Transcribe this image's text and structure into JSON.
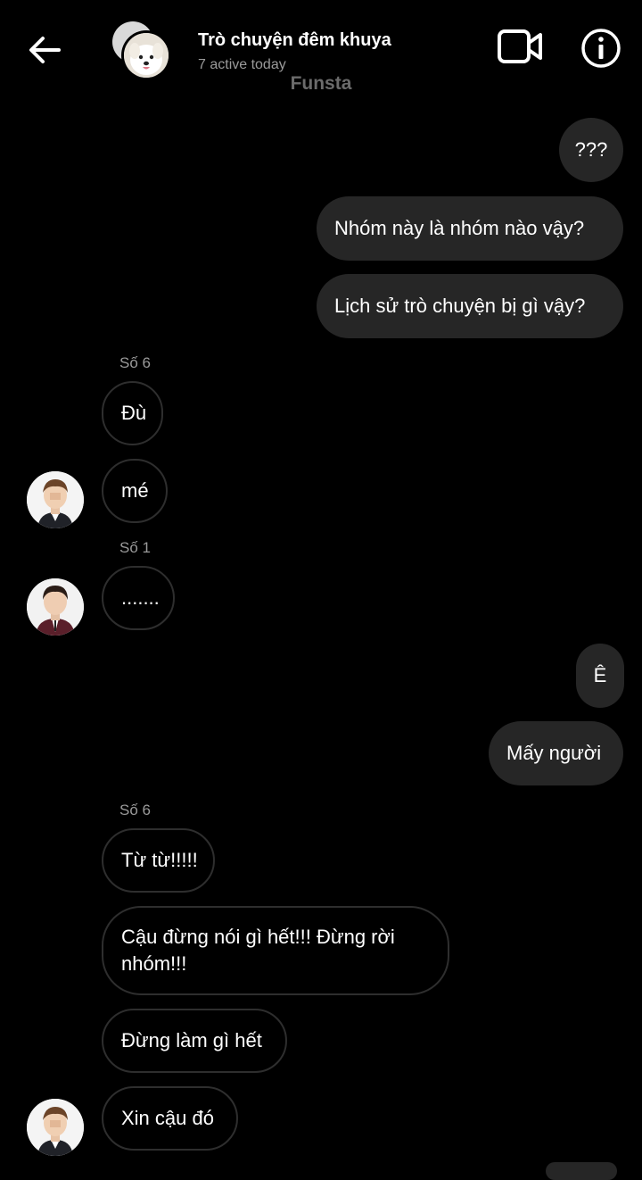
{
  "header": {
    "title": "Trò chuyện đêm khuya",
    "subtitle": "7 active today",
    "app_name": "Funsta",
    "icons": {
      "back": "arrow-left-icon",
      "video": "video-camera-icon",
      "info": "info-icon"
    }
  },
  "colors": {
    "background": "#000000",
    "outgoing_bubble": "#262626",
    "incoming_border": "#2e2e2e",
    "muted_text": "#9a9a9a"
  },
  "messages": {
    "m1": "???",
    "m2": "Nhóm này là nhóm nào vậy?",
    "m3": "Lịch sử trò chuyện bị gì vậy?",
    "sender1": "Số 6",
    "m4": "Đù",
    "m5": "mé",
    "sender2": "Số 1",
    "m6": ".......",
    "m7": "Ê",
    "m8": "Mấy người",
    "sender3": "Số 6",
    "m9": "Từ từ!!!!!",
    "m10": "Cậu đừng nói gì hết!!! Đừng rời nhóm!!!",
    "m11": "Đừng làm gì hết",
    "m12": "Xin cậu đó"
  }
}
